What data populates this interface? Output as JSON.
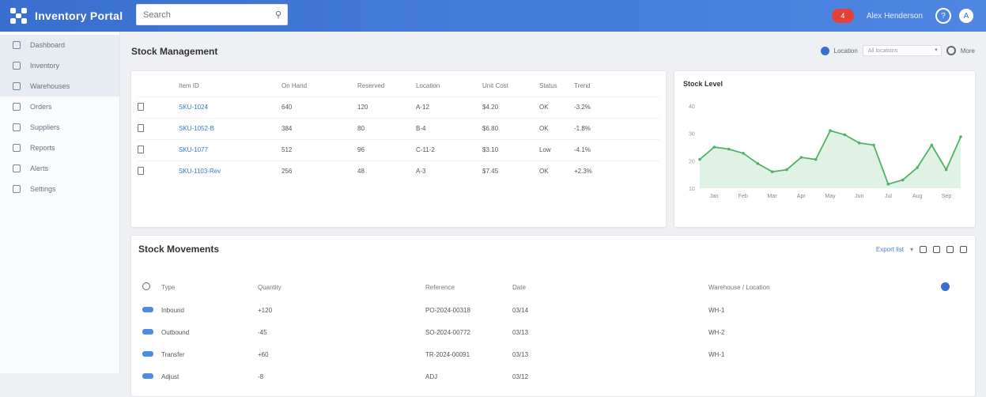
{
  "app": {
    "title": "Inventory Portal"
  },
  "search": {
    "placeholder": "Search",
    "icon": "search-icon"
  },
  "topbar": {
    "notification_count": "4",
    "user_name": "Alex Henderson",
    "help_icon": "help-icon",
    "avatar_initial": "A"
  },
  "sidebar": {
    "items": [
      {
        "label": "Dashboard",
        "icon": "dashboard-icon"
      },
      {
        "label": "Inventory",
        "icon": "inventory-icon"
      },
      {
        "label": "Warehouses",
        "icon": "warehouse-icon"
      },
      {
        "label": "Orders",
        "icon": "orders-icon"
      },
      {
        "label": "Suppliers",
        "icon": "suppliers-icon"
      },
      {
        "label": "Reports",
        "icon": "reports-icon"
      },
      {
        "label": "Alerts",
        "icon": "alerts-icon"
      },
      {
        "label": "Settings",
        "icon": "settings-icon"
      }
    ]
  },
  "page": {
    "title": "Stock Management"
  },
  "toolbar": {
    "filter_label": "Location",
    "select_value": "All locations",
    "settings_label": "More"
  },
  "stock_table": {
    "headers": [
      "Item ID",
      "On Hand",
      "Reserved",
      "Location",
      "Unit Cost",
      "Status",
      "Trend"
    ],
    "rows": [
      [
        "SKU-1024",
        "640",
        "120",
        "A-12",
        "$4.20",
        "OK",
        "-3.2%"
      ],
      [
        "SKU-1052-B",
        "384",
        "80",
        "B-4",
        "$6.80",
        "OK",
        "-1.8%"
      ],
      [
        "SKU-1077",
        "512",
        "96",
        "C-11-2",
        "$3.10",
        "Low",
        "-4.1%"
      ],
      [
        "SKU-1103-Rev",
        "256",
        "48",
        "A-3",
        "$7.45",
        "OK",
        "+2.3%"
      ]
    ]
  },
  "chart": {
    "title": "Stock Level"
  },
  "chart_data": {
    "type": "area",
    "title": "Stock Level",
    "x": [
      "Jan",
      "Feb",
      "Mar",
      "Apr",
      "May",
      "Jun",
      "Jul",
      "Aug",
      "Sep"
    ],
    "y_ticks": [
      "40",
      "30",
      "20",
      "10"
    ],
    "ylim": [
      0,
      40
    ],
    "series": [
      {
        "values": [
          14,
          20,
          19,
          17,
          12,
          8,
          9,
          15,
          14,
          28,
          26,
          22,
          21,
          2,
          4,
          10,
          21,
          9,
          25
        ]
      }
    ],
    "grid": false,
    "color": "#4fb26c"
  },
  "movements": {
    "title": "Stock Movements",
    "export_label": "Export list",
    "headers": [
      "Type",
      "Quantity",
      "Reference",
      "Date",
      "Warehouse / Location"
    ],
    "rows": [
      [
        "Inbound",
        "+120",
        "PO-2024-00318",
        "03/14",
        "WH-1"
      ],
      [
        "Outbound",
        "-45",
        "SO-2024-00772",
        "03/13",
        "WH-2"
      ],
      [
        "Transfer",
        "+60",
        "TR-2024-00091",
        "03/13",
        "WH-1"
      ],
      [
        "Adjust",
        "-8",
        "ADJ",
        "03/12",
        ""
      ]
    ]
  },
  "colors": {
    "accent": "#3a6fcf",
    "danger": "#e05555",
    "success": "#3fa65a"
  }
}
